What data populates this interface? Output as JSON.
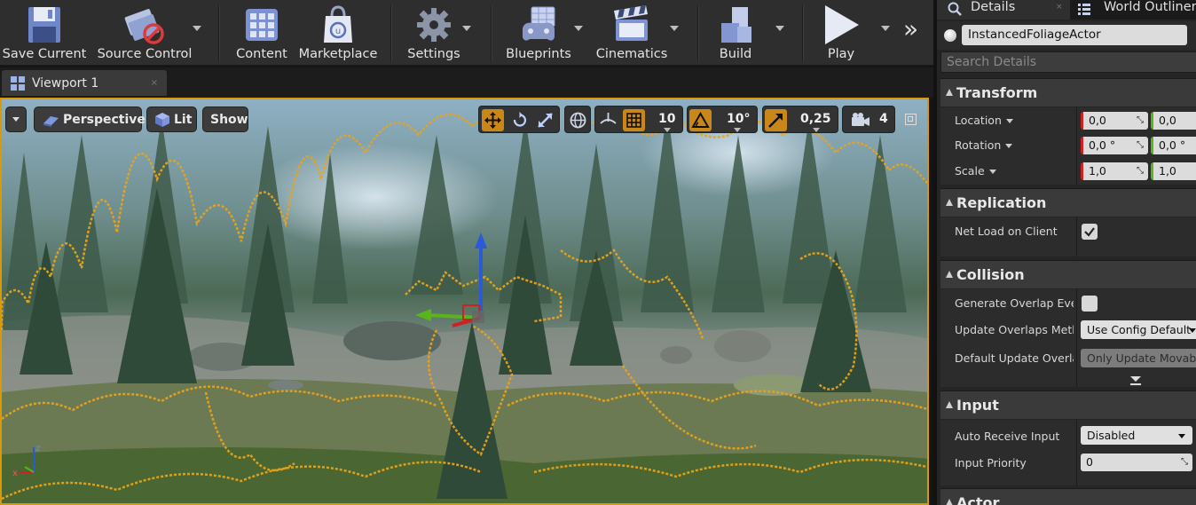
{
  "toolbar": {
    "buttons": [
      {
        "label": "Save Current",
        "icon": "floppy-disk-icon"
      },
      {
        "label": "Source Control",
        "icon": "source-control-icon"
      },
      {
        "label": "Content",
        "icon": "content-browser-icon"
      },
      {
        "label": "Marketplace",
        "icon": "marketplace-bag-icon"
      },
      {
        "label": "Settings",
        "icon": "gear-icon"
      },
      {
        "label": "Blueprints",
        "icon": "gamepad-icon"
      },
      {
        "label": "Cinematics",
        "icon": "clapperboard-icon"
      },
      {
        "label": "Build",
        "icon": "build-cubes-icon"
      },
      {
        "label": "Play",
        "icon": "play-icon"
      }
    ],
    "overflow": "»"
  },
  "viewport_tab": {
    "label": "Viewport 1",
    "close": "×"
  },
  "viewport": {
    "perspective": "Perspective",
    "lit": "Lit",
    "show": "Show",
    "grid_snap": "10",
    "rotation_snap": "10°",
    "scale_snap": "0,25",
    "camera_speed": "4"
  },
  "details": {
    "tab_details": "Details",
    "tab_outliner": "World Outliner",
    "actor_name": "InstancedFoliageActor",
    "search_placeholder": "Search Details",
    "transform": {
      "title": "Transform",
      "location_label": "Location",
      "location_x": "0,0",
      "location_y": "0,0",
      "rotation_label": "Rotation",
      "rotation_x": "0,0 °",
      "rotation_y": "0,0 °",
      "scale_label": "Scale",
      "scale_x": "1,0",
      "scale_y": "1,0"
    },
    "replication": {
      "title": "Replication",
      "net_load_label": "Net Load on Client",
      "net_load_checked": true
    },
    "collision": {
      "title": "Collision",
      "gen_overlap_label": "Generate Overlap Events",
      "gen_overlap_checked": false,
      "update_overlaps_label": "Update Overlaps Method",
      "update_overlaps_value": "Use Config Default",
      "default_update_label": "Default Update Overlaps Method",
      "default_update_value": "Only Update Movable"
    },
    "input": {
      "title": "Input",
      "auto_receive_label": "Auto Receive Input",
      "auto_receive_value": "Disabled",
      "priority_label": "Input Priority",
      "priority_value": "0"
    },
    "actor": {
      "title": "Actor"
    }
  },
  "colors": {
    "selection_outline": "#e8a31a",
    "x_axis": "#cc2222",
    "y_axis": "#58b61a",
    "z_axis": "#2a5ad8"
  }
}
